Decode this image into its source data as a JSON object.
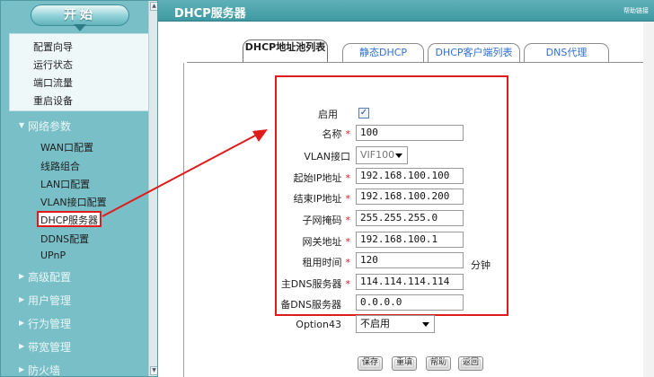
{
  "sidebar": {
    "start_label": "开始",
    "system_items": [
      {
        "label": "配置向导"
      },
      {
        "label": "运行状态"
      },
      {
        "label": "端口流量"
      },
      {
        "label": "重启设备"
      }
    ],
    "network_category": "网络参数",
    "network_items": [
      {
        "label": "WAN口配置"
      },
      {
        "label": "线路组合"
      },
      {
        "label": "LAN口配置"
      },
      {
        "label": "VLAN接口配置"
      },
      {
        "label": "DHCP服务器"
      },
      {
        "label": "DDNS配置"
      },
      {
        "label": "UPnP"
      }
    ],
    "other_categories": [
      {
        "label": "高级配置"
      },
      {
        "label": "用户管理"
      },
      {
        "label": "行为管理"
      },
      {
        "label": "带宽管理"
      },
      {
        "label": "防火墙"
      }
    ]
  },
  "header": {
    "title": "DHCP服务器",
    "right_link": "帮助链接"
  },
  "tabs": [
    {
      "label": "DHCP地址池列表",
      "active": true
    },
    {
      "label": "静态DHCP",
      "active": false
    },
    {
      "label": "DHCP客户端列表",
      "active": false
    },
    {
      "label": "DNS代理",
      "active": false
    }
  ],
  "form": {
    "enable_label": "启用",
    "enable_checked": true,
    "name_label": "名称",
    "name_value": "100",
    "vlan_label": "VLAN接口",
    "vlan_value": "VIF100",
    "start_ip_label": "起始IP地址",
    "start_ip_value": "192.168.100.100",
    "end_ip_label": "结束IP地址",
    "end_ip_value": "192.168.100.200",
    "mask_label": "子网掩码",
    "mask_value": "255.255.255.0",
    "gateway_label": "网关地址",
    "gateway_value": "192.168.100.1",
    "lease_label": "租用时间",
    "lease_value": "120",
    "lease_unit": "分钟",
    "dns1_label": "主DNS服务器",
    "dns1_value": "114.114.114.114",
    "dns2_label": "备DNS服务器",
    "dns2_value": "0.0.0.0",
    "opt43_label": "Option43",
    "opt43_value": "不启用",
    "required_mark": "*"
  },
  "buttons": {
    "save": "保存",
    "reset": "重填",
    "help": "帮助",
    "back": "返回"
  },
  "colors": {
    "sidebar_bg": "#79bfc7",
    "header_bg": "#4ba3ac",
    "highlight_red": "#e01b1b",
    "tab_link": "#2e6fd4"
  }
}
